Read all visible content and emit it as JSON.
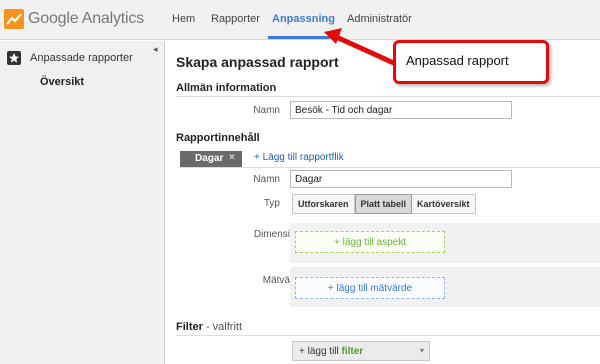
{
  "app": {
    "logo_text": "Google Analytics",
    "brand_colors": {
      "logo_orange": "#f7931e",
      "accent_blue": "#3c7ad6",
      "callout_red": "#e10b0b"
    }
  },
  "nav": {
    "items": [
      {
        "label": "Hem"
      },
      {
        "label": "Rapporter"
      },
      {
        "label": "Anpassning",
        "active": true
      },
      {
        "label": "Administratör"
      }
    ]
  },
  "sidebar": {
    "section_label": "Anpassade rapporter",
    "section_icon": "star-icon",
    "sub_item": "Översikt",
    "collapse_icon": "collapse-left-icon"
  },
  "main": {
    "title": "Skapa anpassad rapport",
    "general": {
      "heading": "Allmän information",
      "name_label": "Namn",
      "name_value": "Besök - Tid och dagar"
    },
    "content": {
      "heading": "Rapportinnehåll",
      "tab_chip_label": "Dagar",
      "tab_chip_close": "×",
      "add_tab_link": "+ Lägg till rapportflik",
      "name_label": "Namn",
      "name_value": "Dagar",
      "type_label": "Typ",
      "type_options": [
        "Utforskaren",
        "Platt tabell",
        "Kartöversikt"
      ],
      "type_selected": "Platt tabell",
      "dimensions_label": "Dimensioner",
      "add_dimension": "+ lägg till aspekt",
      "metrics_label": "Mätvärden",
      "add_metric": "+ lägg till mätvärde"
    },
    "filter": {
      "heading": "Filter",
      "heading_suffix": " - valfritt",
      "add_prefix": "+ lägg till ",
      "add_word": "filter"
    }
  },
  "callout": {
    "text": "Anpassad rapport"
  }
}
